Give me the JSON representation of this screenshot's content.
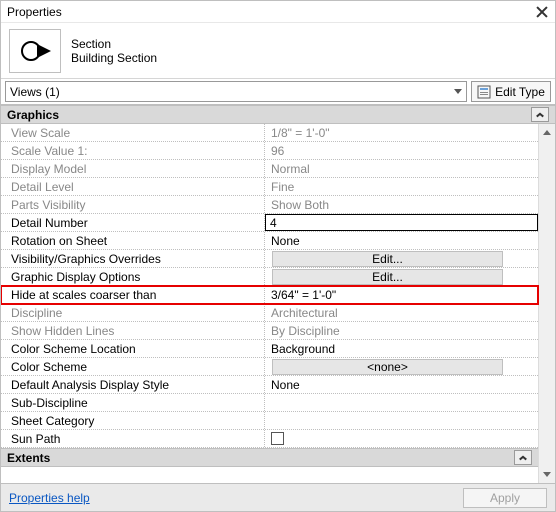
{
  "window": {
    "title": "Properties"
  },
  "type": {
    "family": "Section",
    "type_name": "Building Section"
  },
  "views_selector": {
    "label": "Views (1)"
  },
  "edit_type_label": "Edit Type",
  "sections": {
    "graphics": "Graphics",
    "extents": "Extents"
  },
  "props": {
    "view_scale": {
      "label": "View Scale",
      "value": "1/8\" = 1'-0\""
    },
    "scale_value": {
      "label": "Scale Value    1:",
      "value": "96"
    },
    "display_model": {
      "label": "Display Model",
      "value": "Normal"
    },
    "detail_level": {
      "label": "Detail Level",
      "value": "Fine"
    },
    "parts_visibility": {
      "label": "Parts Visibility",
      "value": "Show Both"
    },
    "detail_number": {
      "label": "Detail Number",
      "value": "4"
    },
    "rotation": {
      "label": "Rotation on Sheet",
      "value": "None"
    },
    "vg_overrides": {
      "label": "Visibility/Graphics Overrides",
      "value": "Edit..."
    },
    "gdo": {
      "label": "Graphic Display Options",
      "value": "Edit..."
    },
    "hide_coarser": {
      "label": "Hide at scales coarser than",
      "value": " 3/64\" = 1'-0\""
    },
    "discipline": {
      "label": "Discipline",
      "value": "Architectural"
    },
    "show_hidden": {
      "label": "Show Hidden Lines",
      "value": "By Discipline"
    },
    "cs_location": {
      "label": "Color Scheme Location",
      "value": "Background"
    },
    "cs": {
      "label": "Color Scheme",
      "value": "<none>"
    },
    "analysis_style": {
      "label": "Default Analysis Display Style",
      "value": "None"
    },
    "sub_discipline": {
      "label": "Sub-Discipline",
      "value": ""
    },
    "sheet_category": {
      "label": "Sheet Category",
      "value": ""
    },
    "sun_path": {
      "label": "Sun Path",
      "value": ""
    }
  },
  "footer": {
    "help": "Properties help",
    "apply": "Apply"
  }
}
